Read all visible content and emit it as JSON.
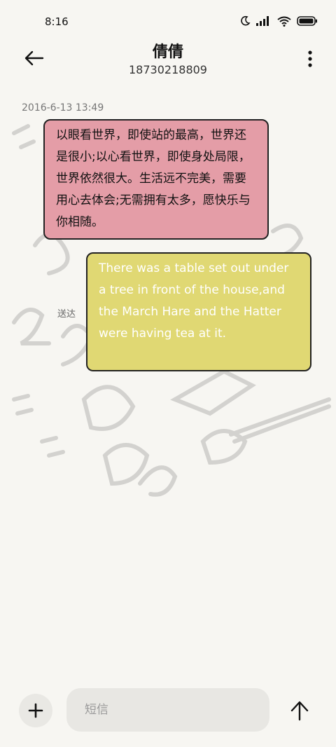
{
  "status": {
    "time": "8:16"
  },
  "header": {
    "title": "倩倩",
    "subtitle": "18730218809"
  },
  "conversation": {
    "timestamp": "2016-6-13 13:49",
    "incoming_message": "以眼看世界，即使站的最高，世界还是很小;以心看世界，即使身处局限，世界依然很大。生活远不完美，需要用心去体会;无需拥有太多，愿快乐与你相随。",
    "outgoing_message": "There was a table set out under a tree in front of the house,and the March Hare and the Hatter were having tea at it.",
    "outgoing_status": "送达"
  },
  "composer": {
    "placeholder": "短信"
  },
  "colors": {
    "incoming_bubble": "#e49da7",
    "outgoing_bubble": "#e0d873",
    "background": "#f7f6f2"
  },
  "icons": [
    "moon-icon",
    "signal-icon",
    "wifi-icon",
    "battery-icon",
    "back-arrow-icon",
    "more-vert-icon",
    "plus-icon",
    "send-arrow-icon"
  ]
}
